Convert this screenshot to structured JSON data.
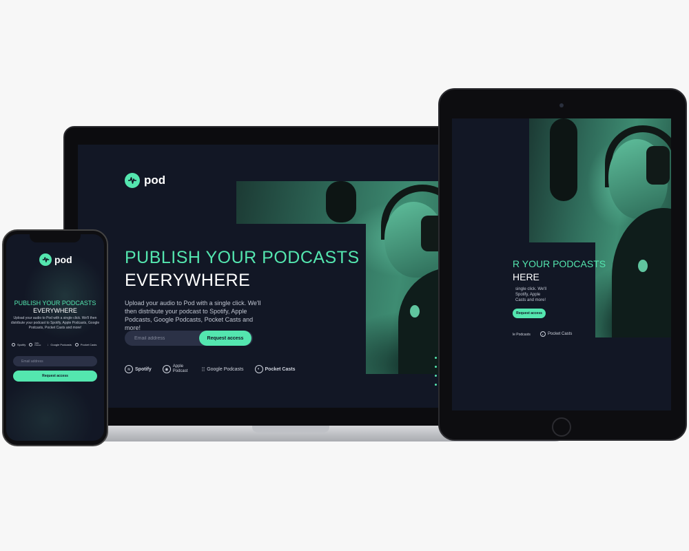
{
  "brand": {
    "name": "pod",
    "accent": "#54e6af",
    "background": "#121725",
    "input_bg": "#2b3146"
  },
  "hero": {
    "headline_line1": "PUBLISH YOUR PODCASTS",
    "headline_line2": "EVERYWHERE",
    "description": "Upload your audio to Pod with a single click. We'll then distribute your podcast to Spotify, Apple Podcasts, Google Podcasts, Pocket Casts and more!",
    "email_placeholder": "Email address",
    "cta_label": "Request access"
  },
  "platforms": [
    {
      "name": "Spotify",
      "icon": "spotify-icon"
    },
    {
      "name": "Apple Podcast",
      "icon": "apple-podcasts-icon"
    },
    {
      "name": "Google Podcasts",
      "icon": "google-podcasts-icon"
    },
    {
      "name": "Pocket Casts",
      "icon": "pocket-casts-icon"
    }
  ],
  "tablet": {
    "headline_line1_partial": "R YOUR PODCASTS",
    "headline_line2_partial": "HERE",
    "desc_fragments": [
      "single click. We'll",
      "Spotify, Apple",
      "Casts and more!"
    ],
    "cta_label": "Request access",
    "platform_labels": [
      "le Podcasts",
      "Pocket Casts"
    ]
  }
}
